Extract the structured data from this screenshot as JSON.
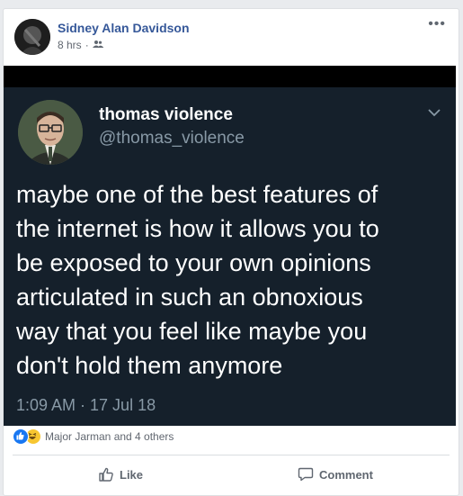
{
  "post": {
    "author": "Sidney Alan Davidson",
    "time": "8 hrs",
    "separator": "·",
    "audience_icon": "friends-icon",
    "more_label": "•••"
  },
  "tweet": {
    "name": "thomas violence",
    "handle": "@thomas_violence",
    "text_lines": [
      "maybe one of the best features of",
      "the internet is how it allows you to",
      "be exposed to your own opinions",
      "articulated in such an obnoxious",
      "way that you feel like maybe you",
      "don't hold them anymore"
    ],
    "timestamp": "1:09 AM · 17 Jul 18",
    "background_color": "#15202b"
  },
  "reactions": {
    "icons": [
      "like-reaction-icon",
      "haha-reaction-icon"
    ],
    "summary": "Major Jarman and 4 others"
  },
  "actions": {
    "like_label": "Like",
    "comment_label": "Comment"
  },
  "colors": {
    "author_link": "#365899",
    "like_blue": "#1877f2",
    "tweet_handle": "#8899a6"
  }
}
